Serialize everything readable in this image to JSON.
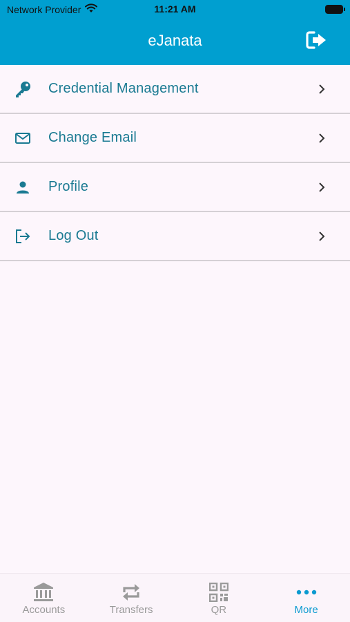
{
  "status_bar": {
    "carrier": "Network Provider",
    "time": "11:21 AM"
  },
  "header": {
    "title": "eJanata"
  },
  "menu": {
    "items": [
      {
        "label": "Credential Management",
        "icon": "key-icon"
      },
      {
        "label": "Change Email",
        "icon": "envelope-icon"
      },
      {
        "label": "Profile",
        "icon": "person-icon"
      },
      {
        "label": "Log Out",
        "icon": "logout-icon"
      }
    ]
  },
  "tabs": [
    {
      "label": "Accounts",
      "icon": "bank-icon",
      "active": false
    },
    {
      "label": "Transfers",
      "icon": "transfer-icon",
      "active": false
    },
    {
      "label": "QR",
      "icon": "qr-icon",
      "active": false
    },
    {
      "label": "More",
      "icon": "more-icon",
      "active": true
    }
  ],
  "colors": {
    "header_bg": "#009fd0",
    "accent_text": "#1a7a92",
    "tab_active": "#0a9ad0",
    "tab_inactive": "#9a9a9a",
    "page_bg": "#fdf6fc"
  }
}
